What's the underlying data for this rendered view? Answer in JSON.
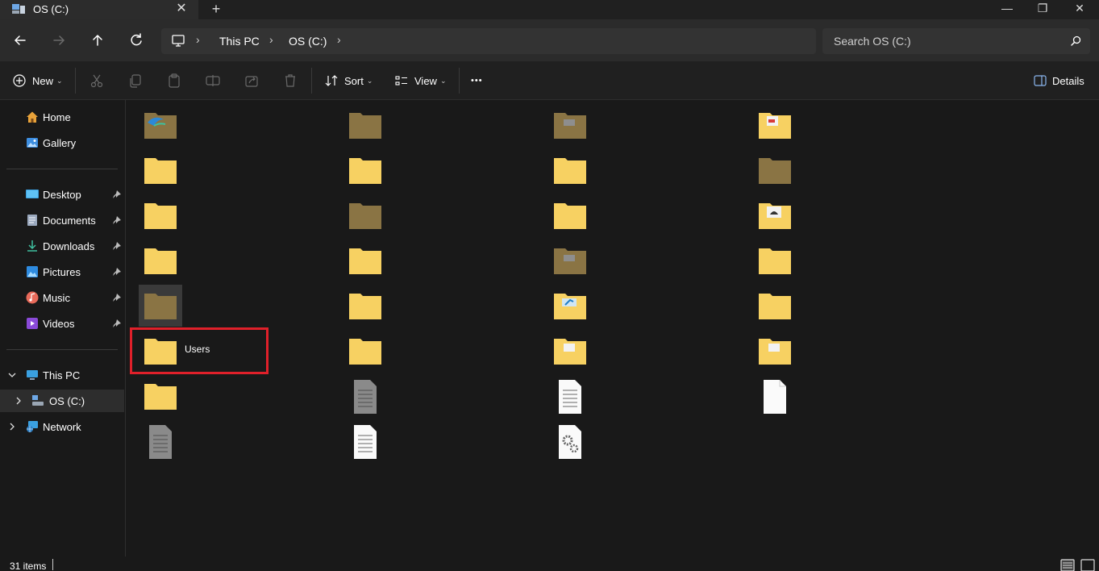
{
  "window": {
    "tab_title": "OS (C:)",
    "tab_close": "✕",
    "new_tab": "+",
    "minimize": "—",
    "maximize": "❐",
    "close": "✕"
  },
  "nav": {
    "breadcrumbs": [
      "This PC",
      "OS (C:)"
    ],
    "search_placeholder": "Search OS (C:)"
  },
  "toolbar": {
    "new_label": "New",
    "sort_label": "Sort",
    "view_label": "View",
    "more_label": "•••",
    "details_label": "Details",
    "icons": [
      "cut-icon",
      "copy-icon",
      "paste-icon",
      "rename-icon",
      "share-icon",
      "delete-icon"
    ]
  },
  "sidebar": {
    "quick": [
      {
        "label": "Home",
        "icon": "home-icon"
      },
      {
        "label": "Gallery",
        "icon": "gallery-icon"
      }
    ],
    "pinned": [
      {
        "label": "Desktop",
        "icon": "desktop-icon"
      },
      {
        "label": "Documents",
        "icon": "documents-icon"
      },
      {
        "label": "Downloads",
        "icon": "downloads-icon"
      },
      {
        "label": "Pictures",
        "icon": "pictures-icon"
      },
      {
        "label": "Music",
        "icon": "music-icon"
      },
      {
        "label": "Videos",
        "icon": "videos-icon"
      }
    ],
    "tree": [
      {
        "label": "This PC",
        "icon": "this-pc-icon",
        "expanded": true
      },
      {
        "label": "OS (C:)",
        "icon": "drive-icon",
        "selected": true
      },
      {
        "label": "Network",
        "icon": "network-icon"
      }
    ]
  },
  "content": {
    "users_label": "Users"
  },
  "status": {
    "item_count": "31 items"
  },
  "colors": {
    "highlight": "#e0202a",
    "folder": "#f7d162",
    "hidden_folder": "#8a7444"
  }
}
